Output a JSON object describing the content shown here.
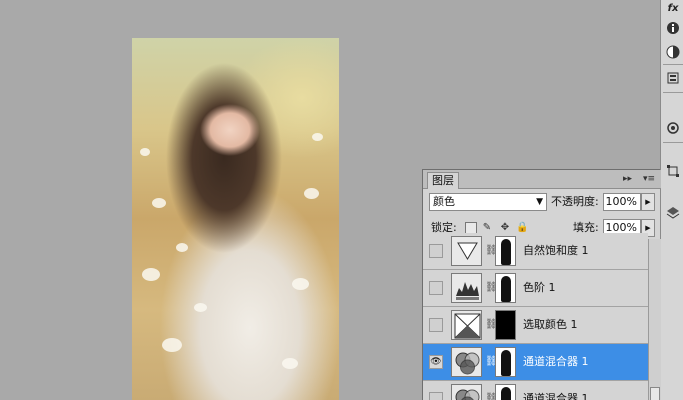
{
  "layers_panel": {
    "tab_label": "图层",
    "blend_mode": "颜色",
    "opacity_label": "不透明度:",
    "opacity_value": "100%",
    "lock_label": "锁定:",
    "fill_label": "填充:",
    "fill_value": "100%",
    "panel_menu_icon": "panel-menu-icon",
    "collapse_icon": "double-arrow-icon",
    "layers": [
      {
        "name": "自然饱和度 1",
        "visible": false,
        "selected": false,
        "thumb": "vibrance-icon",
        "mask": "person-silhouette"
      },
      {
        "name": "色阶 1",
        "visible": false,
        "selected": false,
        "thumb": "levels-icon",
        "mask": "person-silhouette"
      },
      {
        "name": "选取颜色 1",
        "visible": false,
        "selected": false,
        "thumb": "selective-color-icon",
        "mask": "black"
      },
      {
        "name": "通道混合器 1",
        "visible": true,
        "selected": true,
        "thumb": "channel-mixer-icon",
        "mask": "person-silhouette"
      },
      {
        "name": "通道混合器 1",
        "visible": false,
        "selected": false,
        "thumb": "channel-mixer-icon",
        "mask": "person-silhouette"
      }
    ]
  },
  "tools_strip": {
    "top_label": "fx",
    "icons": [
      "info-icon",
      "color-balance-icon",
      "history-icon",
      "pen-path-icon",
      "transform-icon",
      "layer-3d-icon"
    ]
  },
  "colors": {
    "selection_blue": "#3d8ee6",
    "workspace_gray": "#a9a9a9",
    "panel_gray": "#d4d4d4"
  }
}
